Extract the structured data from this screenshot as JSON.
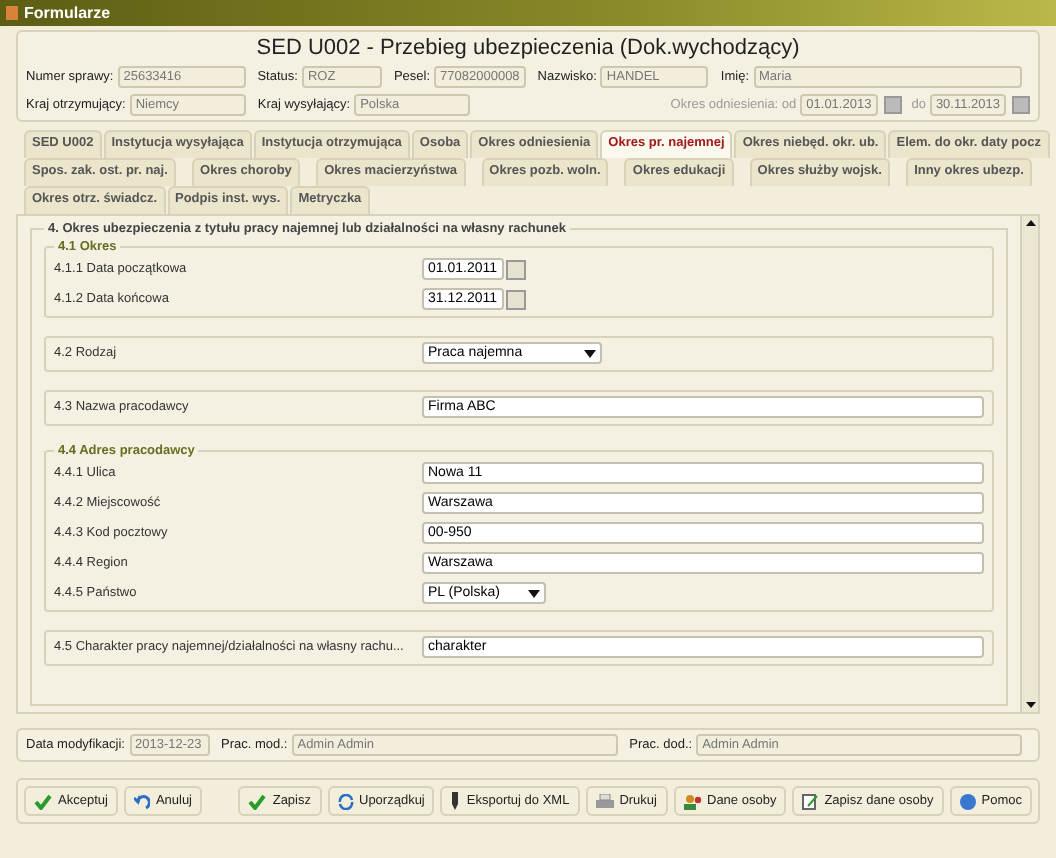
{
  "window": {
    "title": "Formularze"
  },
  "header": {
    "title": "SED U002 - Przebieg ubezpieczenia (Dok.wychodzący)",
    "row_1": [
      {
        "label": "Numer sprawy:",
        "value": "25633416",
        "disabled": true
      },
      {
        "label": "Status:",
        "value": "ROZ",
        "disabled": true
      },
      {
        "label": "Pesel:",
        "value": "77082000008",
        "disabled": true
      },
      {
        "label": "Nazwisko:",
        "value": "HANDEL",
        "disabled": true
      },
      {
        "label": "Imię:",
        "value": "Maria",
        "disabled": true
      }
    ],
    "row_2": [
      {
        "label": "Kraj otrzymujący:",
        "value": "Niemcy",
        "disabled": true
      },
      {
        "label": "Kraj wysyłający:",
        "value": "Polska",
        "disabled": true
      }
    ],
    "period": {
      "label": "Okres odniesienia: od",
      "from": "01.01.2013",
      "to_label": "do",
      "to": "30.11.2013",
      "disabled": true
    }
  },
  "tab_rows": [
    [
      {
        "label": "SED U002",
        "selected": false
      },
      {
        "label": "Instytucja wysyłająca",
        "selected": false
      },
      {
        "label": "Instytucja otrzymująca",
        "selected": false
      },
      {
        "label": "Osoba",
        "selected": false
      },
      {
        "label": "Okres odniesienia",
        "selected": false
      },
      {
        "label": "Okres pr. najemnej",
        "selected": true
      },
      {
        "label": "Okres niebęd. okr. ub.",
        "selected": false
      },
      {
        "label": "Elem. do okr. daty pocz",
        "selected": false
      }
    ],
    [
      {
        "label": "Spos. zak. ost. pr. naj.",
        "selected": false
      },
      {
        "label": "Okres choroby",
        "selected": false
      },
      {
        "label": "Okres macierzyństwa",
        "selected": false
      },
      {
        "label": "Okres pozb. woln.",
        "selected": false
      },
      {
        "label": "Okres edukacji",
        "selected": false
      },
      {
        "label": "Okres służby wojsk.",
        "selected": false
      },
      {
        "label": "Inny okres ubezp.",
        "selected": false
      }
    ],
    [
      {
        "label": "Okres otrz. świadcz.",
        "selected": false
      },
      {
        "label": "Podpis inst. wys.",
        "selected": false
      },
      {
        "label": "Metryczka",
        "selected": false
      }
    ]
  ],
  "form": {
    "title": "4. Okres ubezpieczenia z tytułu pracy najemnej lub działalności na własny rachunek",
    "groups": [
      {
        "title": "4.1 Okres",
        "fields": [
          {
            "kind": "date",
            "label": "4.1.1 Data początkowa",
            "value": "01.01.2011"
          },
          {
            "kind": "date",
            "label": "4.1.2 Data końcowa",
            "value": "31.12.2011"
          }
        ]
      },
      {
        "fields": [
          {
            "kind": "select",
            "label": "4.2 Rodzaj",
            "value": "Praca najemna"
          }
        ]
      },
      {
        "fields": [
          {
            "kind": "text",
            "label": "4.3 Nazwa pracodawcy",
            "value": "Firma ABC"
          }
        ]
      },
      {
        "title": "4.4 Adres pracodawcy",
        "fields": [
          {
            "kind": "text",
            "label": "4.4.1 Ulica",
            "value": "Nowa 11"
          },
          {
            "kind": "text",
            "label": "4.4.2 Miejscowość",
            "value": "Warszawa"
          },
          {
            "kind": "text",
            "label": "4.4.3 Kod pocztowy",
            "value": "00-950"
          },
          {
            "kind": "text",
            "label": "4.4.4 Region",
            "value": "Warszawa"
          },
          {
            "kind": "country",
            "label": "4.4.5 Państwo",
            "value": "PL (Polska)"
          }
        ]
      },
      {
        "fields": [
          {
            "kind": "text",
            "label": "4.5 Charakter pracy najemnej/działalności na własny rachu...",
            "value": "charakter"
          }
        ]
      }
    ]
  },
  "footer": [
    {
      "label": "Data modyfikacji:",
      "value": "2013-12-23",
      "disabled": true
    },
    {
      "label": "Prac. mod.:",
      "value": "Admin Admin",
      "disabled": true
    },
    {
      "label": "Prac. dod.:",
      "value": "Admin Admin",
      "disabled": true
    }
  ],
  "buttons": [
    {
      "label": "Akceptuj"
    },
    {
      "label": "Anuluj"
    },
    {
      "label": "Zapisz"
    },
    {
      "label": "Uporządkuj"
    },
    {
      "label": "Eksportuj do XML"
    },
    {
      "label": "Drukuj"
    },
    {
      "label": "Dane osoby"
    },
    {
      "label": "Zapisz dane osoby"
    },
    {
      "label": "Pomoc"
    }
  ]
}
